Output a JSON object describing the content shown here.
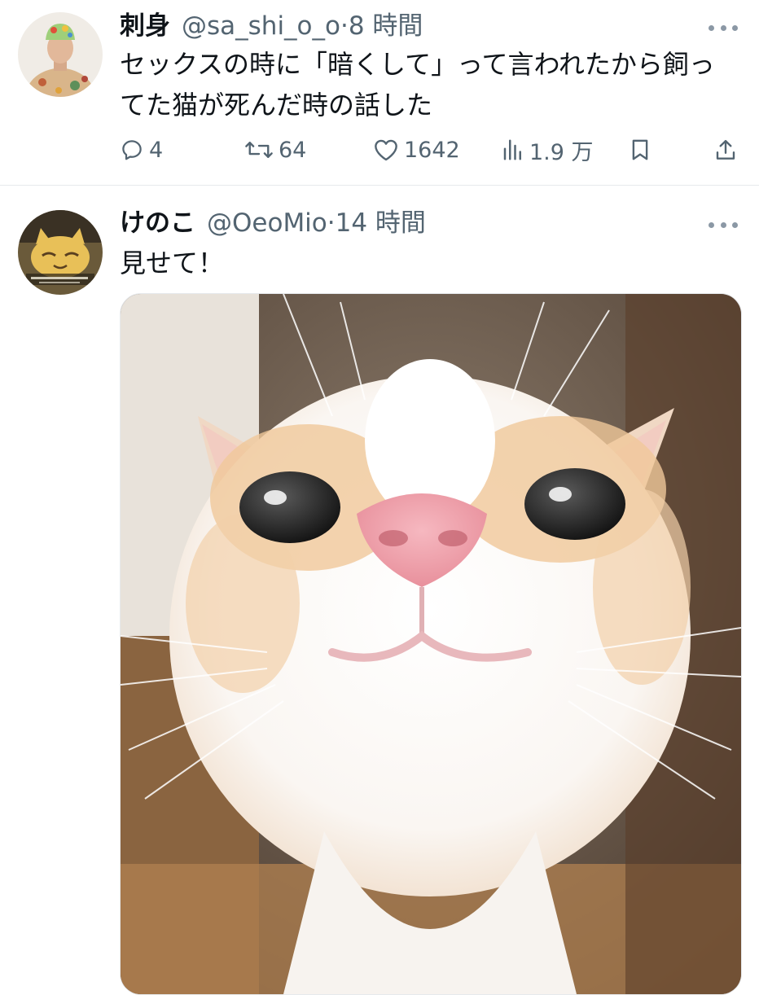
{
  "tweets": [
    {
      "display_name": "刺身",
      "handle": "@sa_shi_o_o",
      "separator": "·",
      "time": "8 時間",
      "text_line1": "セックスの時に「暗くして」って言われたから飼っ",
      "text_line2": "てた猫が死んだ時の話した",
      "actions": {
        "replies": "4",
        "retweets": "64",
        "likes": "1642",
        "views": "1.9 万"
      }
    },
    {
      "display_name": "けのこ",
      "handle": "@OeoMio",
      "separator": "·",
      "time": "14 時間",
      "text": "見せて！"
    }
  ],
  "colors": {
    "primary_text": "#0f1419",
    "secondary_text": "#536471",
    "divider": "#e6e9ec",
    "background": "#ffffff"
  },
  "icons": [
    "more-icon",
    "reply-icon",
    "retweet-icon",
    "like-icon",
    "views-icon",
    "bookmark-icon",
    "share-icon"
  ]
}
